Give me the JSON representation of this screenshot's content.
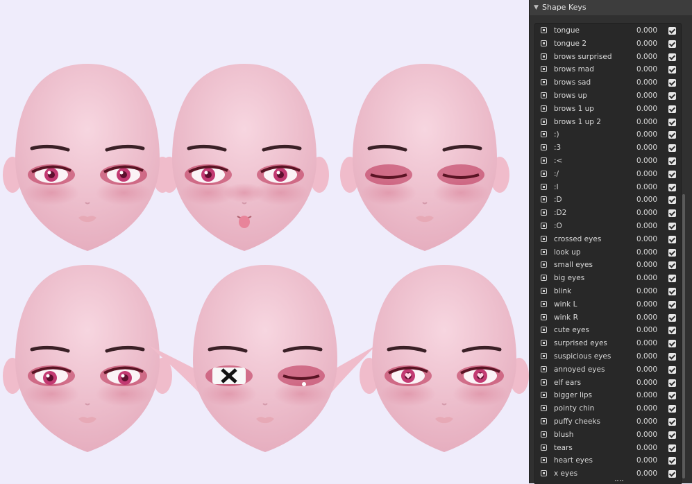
{
  "panel": {
    "title": "Shape Keys",
    "shape_keys": [
      {
        "name": "tongue",
        "value": "0.000",
        "checked": true
      },
      {
        "name": "tongue 2",
        "value": "0.000",
        "checked": true
      },
      {
        "name": "brows surprised",
        "value": "0.000",
        "checked": true
      },
      {
        "name": "brows mad",
        "value": "0.000",
        "checked": true
      },
      {
        "name": "brows sad",
        "value": "0.000",
        "checked": true
      },
      {
        "name": "brows up",
        "value": "0.000",
        "checked": true
      },
      {
        "name": "brows 1 up",
        "value": "0.000",
        "checked": true
      },
      {
        "name": "brows 1 up 2",
        "value": "0.000",
        "checked": true
      },
      {
        "name": ":)",
        "value": "0.000",
        "checked": true
      },
      {
        "name": ":3",
        "value": "0.000",
        "checked": true
      },
      {
        "name": ":<",
        "value": "0.000",
        "checked": true
      },
      {
        "name": ":/",
        "value": "0.000",
        "checked": true
      },
      {
        "name": ":I",
        "value": "0.000",
        "checked": true
      },
      {
        "name": ":D",
        "value": "0.000",
        "checked": true
      },
      {
        "name": ":D2",
        "value": "0.000",
        "checked": true
      },
      {
        "name": ":O",
        "value": "0.000",
        "checked": true
      },
      {
        "name": "crossed eyes",
        "value": "0.000",
        "checked": true
      },
      {
        "name": "look up",
        "value": "0.000",
        "checked": true
      },
      {
        "name": "small eyes",
        "value": "0.000",
        "checked": true
      },
      {
        "name": "big eyes",
        "value": "0.000",
        "checked": true
      },
      {
        "name": "blink",
        "value": "0.000",
        "checked": true
      },
      {
        "name": "wink L",
        "value": "0.000",
        "checked": true
      },
      {
        "name": "wink R",
        "value": "0.000",
        "checked": true
      },
      {
        "name": "cute eyes",
        "value": "0.000",
        "checked": true
      },
      {
        "name": "surprised eyes",
        "value": "0.000",
        "checked": true
      },
      {
        "name": "suspicious eyes",
        "value": "0.000",
        "checked": true
      },
      {
        "name": "annoyed eyes",
        "value": "0.000",
        "checked": true
      },
      {
        "name": "elf ears",
        "value": "0.000",
        "checked": true
      },
      {
        "name": "bigger lips",
        "value": "0.000",
        "checked": true
      },
      {
        "name": "pointy chin",
        "value": "0.000",
        "checked": true
      },
      {
        "name": "puffy cheeks",
        "value": "0.000",
        "checked": true
      },
      {
        "name": "blush",
        "value": "0.000",
        "checked": true
      },
      {
        "name": "tears",
        "value": "0.000",
        "checked": true
      },
      {
        "name": "heart eyes",
        "value": "0.000",
        "checked": true
      },
      {
        "name": "x eyes",
        "value": "0.000",
        "checked": true
      }
    ]
  },
  "icons": {
    "collapse": "chevron-down-icon",
    "shape_key": "shape-key-icon",
    "enabled": "checkbox-icon"
  },
  "colors": {
    "skin": "#f4cbd8",
    "eyeshadow": "#b8284e",
    "brow": "#3a2026",
    "viewport_bg": "#efecfb",
    "panel_bg": "#303030"
  }
}
